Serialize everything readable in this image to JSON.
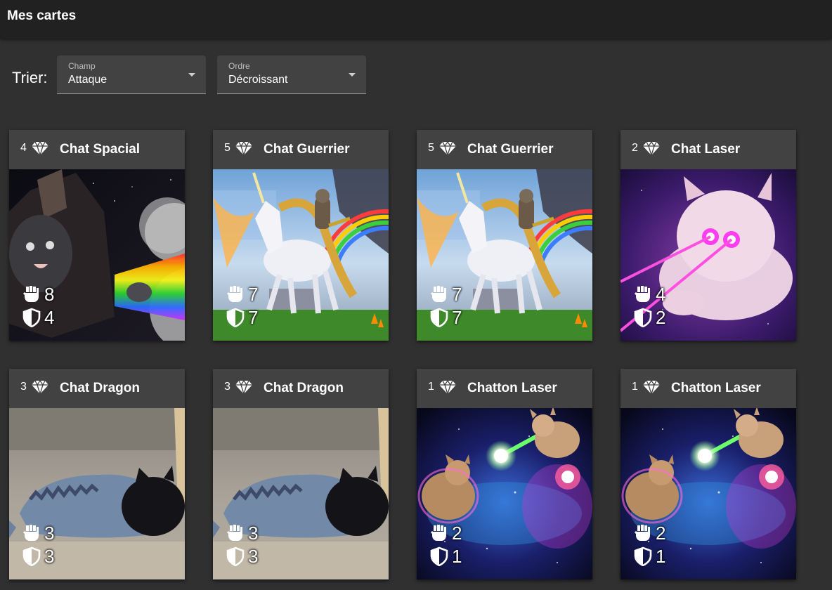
{
  "app": {
    "title": "Mes cartes"
  },
  "sort": {
    "label": "Trier:",
    "field": {
      "label": "Champ",
      "value": "Attaque"
    },
    "order": {
      "label": "Ordre",
      "value": "Décroissant"
    }
  },
  "icons": {
    "cost": "diamond-icon",
    "attack": "fist-icon",
    "defense": "shield-icon"
  },
  "cards": [
    {
      "cost": "4",
      "name": "Chat Spacial",
      "attack": "8",
      "defense": "4",
      "art": "space"
    },
    {
      "cost": "5",
      "name": "Chat Guerrier",
      "attack": "7",
      "defense": "7",
      "art": "unicorn"
    },
    {
      "cost": "5",
      "name": "Chat Guerrier",
      "attack": "7",
      "defense": "7",
      "art": "unicorn"
    },
    {
      "cost": "2",
      "name": "Chat Laser",
      "attack": "4",
      "defense": "2",
      "art": "laser"
    },
    {
      "cost": "3",
      "name": "Chat Dragon",
      "attack": "3",
      "defense": "3",
      "art": "dragon"
    },
    {
      "cost": "3",
      "name": "Chat Dragon",
      "attack": "3",
      "defense": "3",
      "art": "dragon"
    },
    {
      "cost": "1",
      "name": "Chatton Laser",
      "attack": "2",
      "defense": "1",
      "art": "kittens"
    },
    {
      "cost": "1",
      "name": "Chatton Laser",
      "attack": "2",
      "defense": "1",
      "art": "kittens"
    }
  ]
}
